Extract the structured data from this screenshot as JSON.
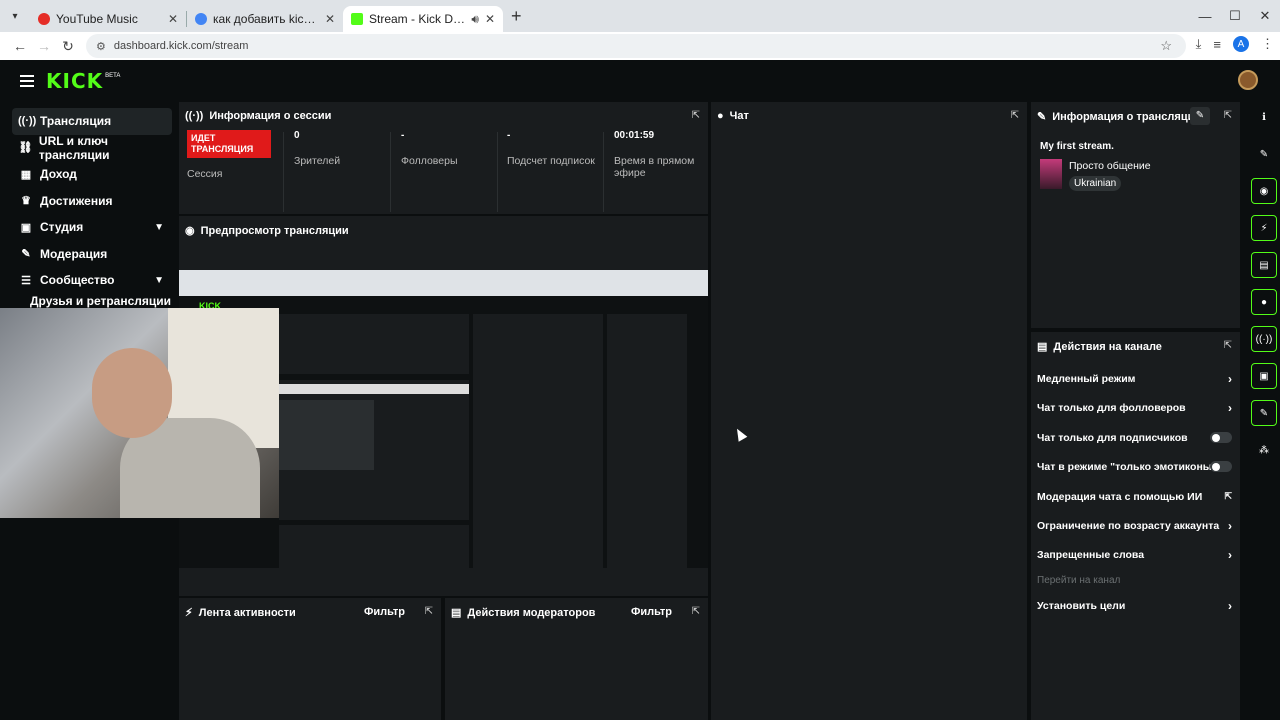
{
  "browser": {
    "tabs": [
      {
        "label": "YouTube Music",
        "favicon_color": "#e52d27",
        "active": false
      },
      {
        "label": "как добавить kick акк обс - Go",
        "favicon_color": "#4285f4",
        "active": false
      },
      {
        "label": "Stream - Kick Dashboard",
        "favicon_color": "#53fc18",
        "active": true
      }
    ],
    "url": "dashboard.kick.com/stream",
    "account_initial": "A"
  },
  "header": {
    "logo": "KICK",
    "beta": "BETA"
  },
  "sidebar": {
    "items": [
      {
        "label": "Трансляция",
        "icon": "broadcast-icon"
      },
      {
        "label": "URL и ключ трансляции",
        "icon": "link-icon"
      },
      {
        "label": "Доход",
        "icon": "chart-icon"
      },
      {
        "label": "Достижения",
        "icon": "trophy-icon"
      },
      {
        "label": "Студия",
        "icon": "studio-icon"
      },
      {
        "label": "Модерация",
        "icon": "wrench-icon"
      },
      {
        "label": "Сообщество",
        "icon": "community-icon"
      },
      {
        "label": "Друзья и ретрансляции",
        "icon": "friends-icon"
      }
    ]
  },
  "session": {
    "title": "Информация о сессии",
    "badge": "ИДЕТ ТРАНСЛЯЦИЯ",
    "badge_sub": "Сессия",
    "stats": [
      {
        "value": "0",
        "label": "Зрителей"
      },
      {
        "value": "-",
        "label": "Фолловеры"
      },
      {
        "value": "-",
        "label": "Подсчет подписок"
      },
      {
        "value": "00:01:59",
        "label": "Время в прямом эфире"
      }
    ]
  },
  "preview": {
    "title": "Предпросмотр трансляции"
  },
  "chat": {
    "title": "Чат"
  },
  "stream_info": {
    "title": "Информация о трансляции",
    "stream_title": "My first stream.",
    "category": "Просто общение",
    "language": "Ukrainian"
  },
  "activity": {
    "title": "Лента активности",
    "filter": "Фильтр"
  },
  "mod_actions": {
    "title": "Действия модераторов",
    "filter": "Фильтр"
  },
  "channel_actions": {
    "title": "Действия на канале",
    "items": [
      {
        "label": "Медленный режим",
        "control": "chevron"
      },
      {
        "label": "Чат только для фолловеров",
        "control": "chevron"
      },
      {
        "label": "Чат только для подписчиков",
        "control": "toggle"
      },
      {
        "label": "Чат в режиме \"только эмотиконы\"",
        "control": "toggle"
      },
      {
        "label": "Модерация чата с помощью ИИ",
        "control": "external"
      },
      {
        "label": "Ограничение по возрасту аккаунта",
        "control": "chevron"
      },
      {
        "label": "Запрещенные слова",
        "control": "chevron"
      },
      {
        "label": "Перейти на канал",
        "control": "none"
      },
      {
        "label": "Установить цели",
        "control": "chevron"
      }
    ]
  },
  "colors": {
    "accent": "#53fc18",
    "live": "#e01a1a",
    "panel": "#191c1e",
    "bg": "#0b0e0f"
  }
}
